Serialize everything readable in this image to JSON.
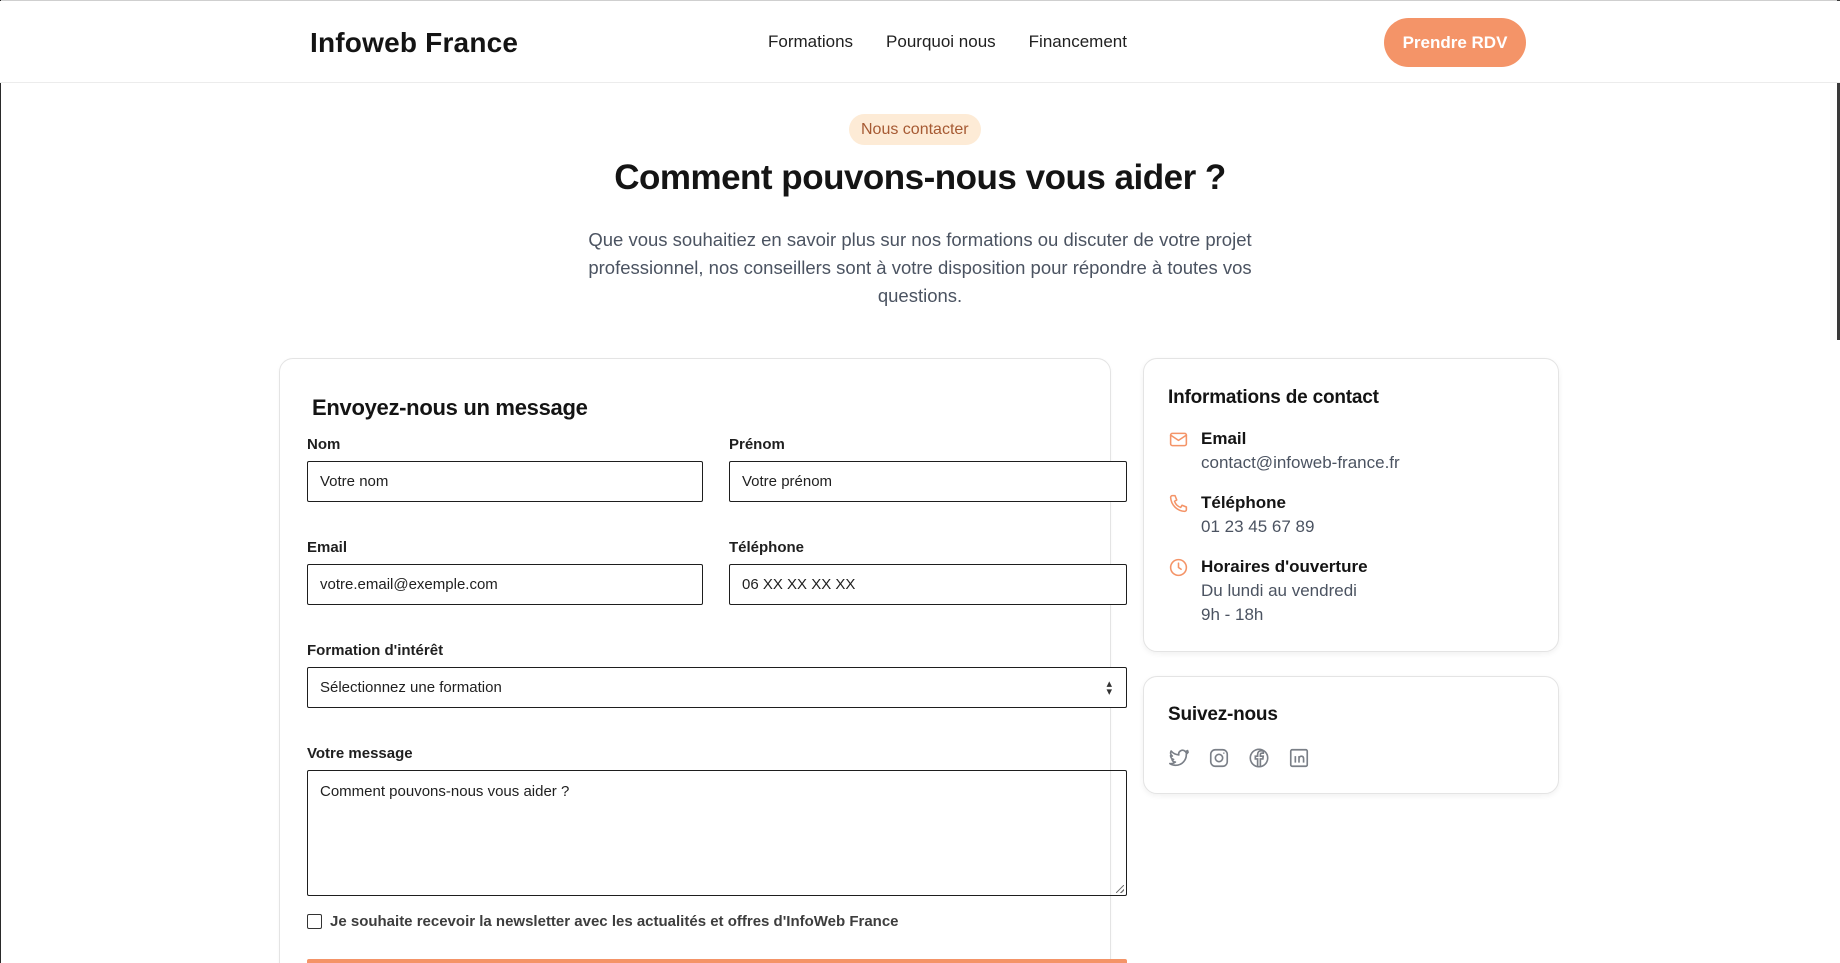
{
  "header": {
    "logo": "Infoweb France",
    "nav": [
      "Formations",
      "Pourquoi nous",
      "Financement"
    ],
    "cta_label": "Prendre RDV"
  },
  "hero": {
    "badge": "Nous contacter",
    "title": "Comment pouvons-nous vous aider ?",
    "intro": "Que vous souhaitiez en savoir plus sur nos formations ou discuter de votre projet professionnel, nos conseillers sont à votre disposition pour répondre à toutes vos questions."
  },
  "form": {
    "title": "Envoyez-nous un message",
    "nom": {
      "label": "Nom",
      "placeholder": "Votre nom"
    },
    "prenom": {
      "label": "Prénom",
      "placeholder": "Votre prénom"
    },
    "email": {
      "label": "Email",
      "placeholder": "votre.email@exemple.com"
    },
    "telephone": {
      "label": "Téléphone",
      "placeholder": "06 XX XX XX XX"
    },
    "formation": {
      "label": "Formation d'intérêt",
      "selected": "Sélectionnez une formation"
    },
    "message": {
      "label": "Votre message",
      "placeholder": "Comment pouvons-nous vous aider ?"
    },
    "newsletter_label": "Je souhaite recevoir la newsletter avec les actualités et offres d'InfoWeb France",
    "newsletter_checked": false
  },
  "contact_info": {
    "title": "Informations de contact",
    "email": {
      "label": "Email",
      "value": "contact@infoweb-france.fr",
      "icon": "mail-icon"
    },
    "phone": {
      "label": "Téléphone",
      "value": "01 23 45 67 89",
      "icon": "phone-icon"
    },
    "hours": {
      "label": "Horaires d'ouverture",
      "days": "Du lundi au vendredi",
      "time": "9h - 18h",
      "icon": "clock-icon"
    }
  },
  "social": {
    "title": "Suivez-nous",
    "icons": [
      "twitter-icon",
      "instagram-icon",
      "facebook-icon",
      "linkedin-icon"
    ]
  },
  "colors": {
    "accent": "#f49468",
    "badge_bg": "#fdebd6",
    "badge_text": "#a65a33",
    "muted_text": "#4b5361",
    "icon_gray": "#7a7f87"
  }
}
